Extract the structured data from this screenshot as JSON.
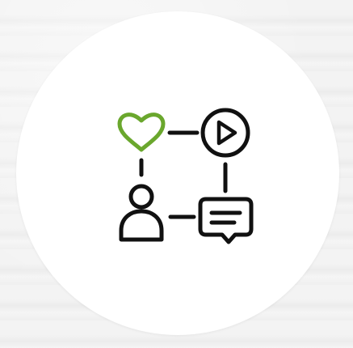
{
  "colors": {
    "background": "#f0f0f0",
    "circle": "#ffffff",
    "stroke": "#111111",
    "heart": "#6aa72d"
  },
  "icons": {
    "heart": "heart-icon",
    "play": "play-circle-icon",
    "user": "user-icon",
    "chat": "chat-bubble-icon",
    "connectors": "connector-lines"
  }
}
